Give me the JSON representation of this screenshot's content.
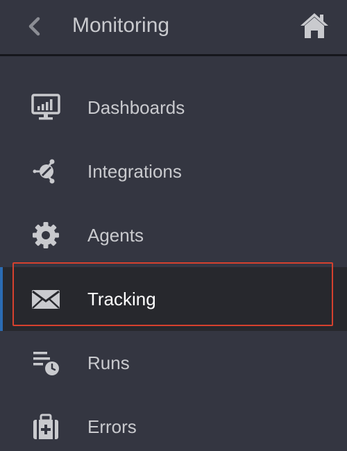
{
  "header": {
    "title": "Monitoring",
    "back_icon": "chevron-left-icon",
    "home_icon": "home-icon"
  },
  "menu": {
    "items": [
      {
        "label": "Dashboards",
        "icon": "monitor-chart-icon",
        "active": false
      },
      {
        "label": "Integrations",
        "icon": "integrations-hub-icon",
        "active": false
      },
      {
        "label": "Agents",
        "icon": "gear-icon",
        "active": false
      },
      {
        "label": "Tracking",
        "icon": "envelope-icon",
        "active": true
      },
      {
        "label": "Runs",
        "icon": "list-clock-icon",
        "active": false
      },
      {
        "label": "Errors",
        "icon": "medical-kit-icon",
        "active": false
      }
    ]
  },
  "colors": {
    "background": "#343641",
    "active_background": "#27282d",
    "active_indicator": "#2b6cb3",
    "highlight_outline": "#d6412e",
    "text": "#c9cace",
    "active_text": "#ffffff"
  }
}
